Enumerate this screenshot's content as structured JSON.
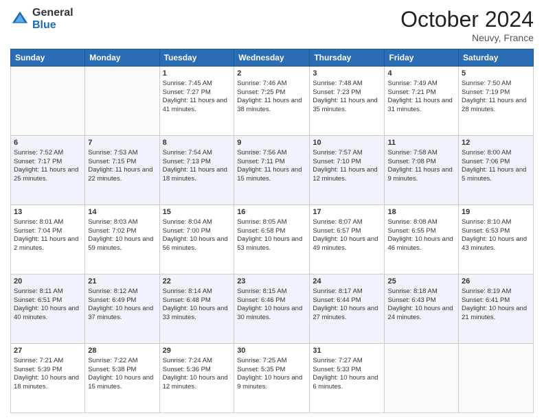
{
  "header": {
    "logo_general": "General",
    "logo_blue": "Blue",
    "month_title": "October 2024",
    "location": "Neuvy, France"
  },
  "weekdays": [
    "Sunday",
    "Monday",
    "Tuesday",
    "Wednesday",
    "Thursday",
    "Friday",
    "Saturday"
  ],
  "weeks": [
    [
      {
        "day": "",
        "sunrise": "",
        "sunset": "",
        "daylight": ""
      },
      {
        "day": "",
        "sunrise": "",
        "sunset": "",
        "daylight": ""
      },
      {
        "day": "1",
        "sunrise": "Sunrise: 7:45 AM",
        "sunset": "Sunset: 7:27 PM",
        "daylight": "Daylight: 11 hours and 41 minutes."
      },
      {
        "day": "2",
        "sunrise": "Sunrise: 7:46 AM",
        "sunset": "Sunset: 7:25 PM",
        "daylight": "Daylight: 11 hours and 38 minutes."
      },
      {
        "day": "3",
        "sunrise": "Sunrise: 7:48 AM",
        "sunset": "Sunset: 7:23 PM",
        "daylight": "Daylight: 11 hours and 35 minutes."
      },
      {
        "day": "4",
        "sunrise": "Sunrise: 7:49 AM",
        "sunset": "Sunset: 7:21 PM",
        "daylight": "Daylight: 11 hours and 31 minutes."
      },
      {
        "day": "5",
        "sunrise": "Sunrise: 7:50 AM",
        "sunset": "Sunset: 7:19 PM",
        "daylight": "Daylight: 11 hours and 28 minutes."
      }
    ],
    [
      {
        "day": "6",
        "sunrise": "Sunrise: 7:52 AM",
        "sunset": "Sunset: 7:17 PM",
        "daylight": "Daylight: 11 hours and 25 minutes."
      },
      {
        "day": "7",
        "sunrise": "Sunrise: 7:53 AM",
        "sunset": "Sunset: 7:15 PM",
        "daylight": "Daylight: 11 hours and 22 minutes."
      },
      {
        "day": "8",
        "sunrise": "Sunrise: 7:54 AM",
        "sunset": "Sunset: 7:13 PM",
        "daylight": "Daylight: 11 hours and 18 minutes."
      },
      {
        "day": "9",
        "sunrise": "Sunrise: 7:56 AM",
        "sunset": "Sunset: 7:11 PM",
        "daylight": "Daylight: 11 hours and 15 minutes."
      },
      {
        "day": "10",
        "sunrise": "Sunrise: 7:57 AM",
        "sunset": "Sunset: 7:10 PM",
        "daylight": "Daylight: 11 hours and 12 minutes."
      },
      {
        "day": "11",
        "sunrise": "Sunrise: 7:58 AM",
        "sunset": "Sunset: 7:08 PM",
        "daylight": "Daylight: 11 hours and 9 minutes."
      },
      {
        "day": "12",
        "sunrise": "Sunrise: 8:00 AM",
        "sunset": "Sunset: 7:06 PM",
        "daylight": "Daylight: 11 hours and 5 minutes."
      }
    ],
    [
      {
        "day": "13",
        "sunrise": "Sunrise: 8:01 AM",
        "sunset": "Sunset: 7:04 PM",
        "daylight": "Daylight: 11 hours and 2 minutes."
      },
      {
        "day": "14",
        "sunrise": "Sunrise: 8:03 AM",
        "sunset": "Sunset: 7:02 PM",
        "daylight": "Daylight: 10 hours and 59 minutes."
      },
      {
        "day": "15",
        "sunrise": "Sunrise: 8:04 AM",
        "sunset": "Sunset: 7:00 PM",
        "daylight": "Daylight: 10 hours and 56 minutes."
      },
      {
        "day": "16",
        "sunrise": "Sunrise: 8:05 AM",
        "sunset": "Sunset: 6:58 PM",
        "daylight": "Daylight: 10 hours and 53 minutes."
      },
      {
        "day": "17",
        "sunrise": "Sunrise: 8:07 AM",
        "sunset": "Sunset: 6:57 PM",
        "daylight": "Daylight: 10 hours and 49 minutes."
      },
      {
        "day": "18",
        "sunrise": "Sunrise: 8:08 AM",
        "sunset": "Sunset: 6:55 PM",
        "daylight": "Daylight: 10 hours and 46 minutes."
      },
      {
        "day": "19",
        "sunrise": "Sunrise: 8:10 AM",
        "sunset": "Sunset: 6:53 PM",
        "daylight": "Daylight: 10 hours and 43 minutes."
      }
    ],
    [
      {
        "day": "20",
        "sunrise": "Sunrise: 8:11 AM",
        "sunset": "Sunset: 6:51 PM",
        "daylight": "Daylight: 10 hours and 40 minutes."
      },
      {
        "day": "21",
        "sunrise": "Sunrise: 8:12 AM",
        "sunset": "Sunset: 6:49 PM",
        "daylight": "Daylight: 10 hours and 37 minutes."
      },
      {
        "day": "22",
        "sunrise": "Sunrise: 8:14 AM",
        "sunset": "Sunset: 6:48 PM",
        "daylight": "Daylight: 10 hours and 33 minutes."
      },
      {
        "day": "23",
        "sunrise": "Sunrise: 8:15 AM",
        "sunset": "Sunset: 6:46 PM",
        "daylight": "Daylight: 10 hours and 30 minutes."
      },
      {
        "day": "24",
        "sunrise": "Sunrise: 8:17 AM",
        "sunset": "Sunset: 6:44 PM",
        "daylight": "Daylight: 10 hours and 27 minutes."
      },
      {
        "day": "25",
        "sunrise": "Sunrise: 8:18 AM",
        "sunset": "Sunset: 6:43 PM",
        "daylight": "Daylight: 10 hours and 24 minutes."
      },
      {
        "day": "26",
        "sunrise": "Sunrise: 8:19 AM",
        "sunset": "Sunset: 6:41 PM",
        "daylight": "Daylight: 10 hours and 21 minutes."
      }
    ],
    [
      {
        "day": "27",
        "sunrise": "Sunrise: 7:21 AM",
        "sunset": "Sunset: 5:39 PM",
        "daylight": "Daylight: 10 hours and 18 minutes."
      },
      {
        "day": "28",
        "sunrise": "Sunrise: 7:22 AM",
        "sunset": "Sunset: 5:38 PM",
        "daylight": "Daylight: 10 hours and 15 minutes."
      },
      {
        "day": "29",
        "sunrise": "Sunrise: 7:24 AM",
        "sunset": "Sunset: 5:36 PM",
        "daylight": "Daylight: 10 hours and 12 minutes."
      },
      {
        "day": "30",
        "sunrise": "Sunrise: 7:25 AM",
        "sunset": "Sunset: 5:35 PM",
        "daylight": "Daylight: 10 hours and 9 minutes."
      },
      {
        "day": "31",
        "sunrise": "Sunrise: 7:27 AM",
        "sunset": "Sunset: 5:33 PM",
        "daylight": "Daylight: 10 hours and 6 minutes."
      },
      {
        "day": "",
        "sunrise": "",
        "sunset": "",
        "daylight": ""
      },
      {
        "day": "",
        "sunrise": "",
        "sunset": "",
        "daylight": ""
      }
    ]
  ]
}
